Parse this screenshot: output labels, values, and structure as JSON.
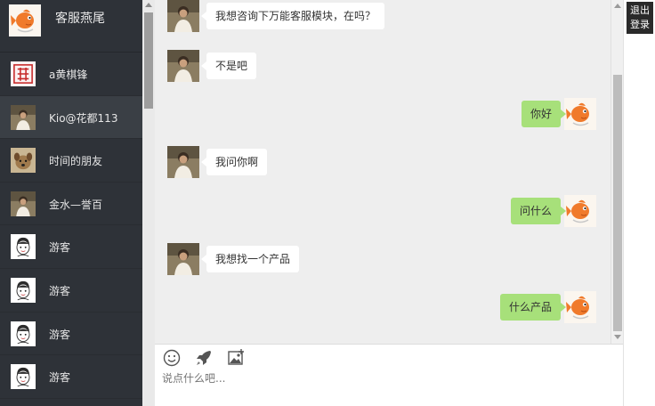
{
  "sidebar": {
    "header": {
      "name": "客服燕尾",
      "avatar_icon": "goldfish-avatar-icon"
    },
    "items": [
      {
        "label": "a黄棋锋",
        "avatar_icon": "red-seal-avatar-icon",
        "active": false
      },
      {
        "label": "Kio@花都113",
        "avatar_icon": "person-photo-avatar-icon",
        "active": true
      },
      {
        "label": "时间的朋友",
        "avatar_icon": "dog-photo-avatar-icon",
        "active": false
      },
      {
        "label": "金水—誉百",
        "avatar_icon": "person-photo-avatar-icon",
        "active": false
      },
      {
        "label": "游客",
        "avatar_icon": "cartoon-guest-avatar-icon",
        "active": false
      },
      {
        "label": "游客",
        "avatar_icon": "cartoon-guest-avatar-icon",
        "active": false
      },
      {
        "label": "游客",
        "avatar_icon": "cartoon-guest-avatar-icon",
        "active": false
      },
      {
        "label": "游客",
        "avatar_icon": "cartoon-guest-avatar-icon",
        "active": false
      }
    ]
  },
  "chat": {
    "messages": [
      {
        "side": "left",
        "text": "我想咨询下万能客服模块，在吗？"
      },
      {
        "side": "left",
        "text": "不是吧"
      },
      {
        "side": "right",
        "text": "你好"
      },
      {
        "side": "left",
        "text": "我问你啊"
      },
      {
        "side": "right",
        "text": "问什么"
      },
      {
        "side": "left",
        "text": "我想找一个产品"
      },
      {
        "side": "right",
        "text": "什么产品"
      }
    ]
  },
  "input": {
    "placeholder": "说点什么吧...",
    "tools": [
      "emoji-icon",
      "rocket-icon",
      "image-icon"
    ]
  },
  "logout_label": "退出\n登录",
  "colors": {
    "sidebar_bg": "#2e3238",
    "chat_bg": "#eeeeee",
    "bubble_self": "#a7e07a",
    "bubble_other": "#ffffff"
  }
}
